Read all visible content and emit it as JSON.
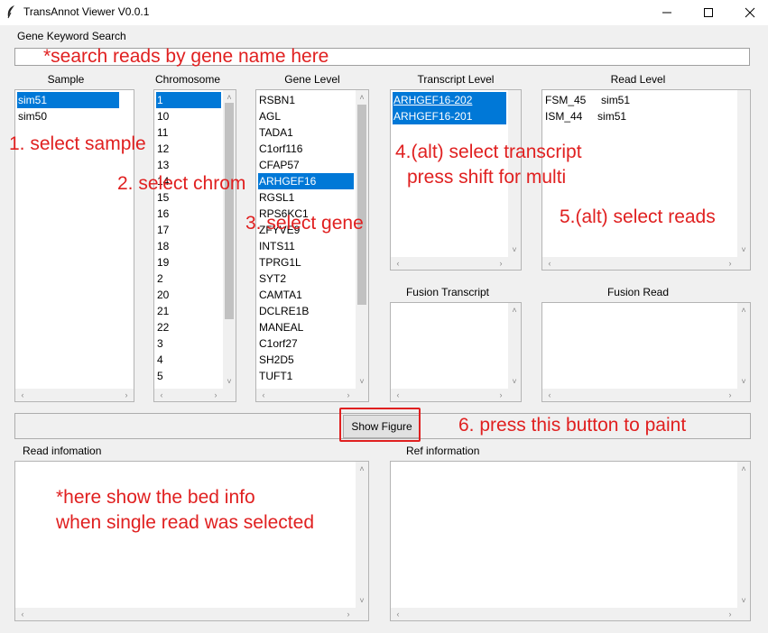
{
  "window": {
    "title": "TransAnnot Viewer V0.0.1",
    "minimize": "—",
    "maximize": "☐",
    "close": "✕"
  },
  "search": {
    "label": "Gene Keyword Search",
    "value": ""
  },
  "sample": {
    "label": "Sample",
    "items": [
      "sim51",
      "sim50"
    ],
    "selected": 0
  },
  "chromosome": {
    "label": "Chromosome",
    "items": [
      "1",
      "10",
      "11",
      "12",
      "13",
      "14",
      "15",
      "16",
      "17",
      "18",
      "19",
      "2",
      "20",
      "21",
      "22",
      "3",
      "4",
      "5"
    ],
    "selected": 0
  },
  "gene": {
    "label": "Gene Level",
    "items": [
      "RSBN1",
      "AGL",
      "TADA1",
      "C1orf116",
      "CFAP57",
      "ARHGEF16",
      "RGSL1",
      "RPS6KC1",
      "ZFYVE9",
      "INTS11",
      "TPRG1L",
      "SYT2",
      "CAMTA1",
      "DCLRE1B",
      "MANEAL",
      "C1orf27",
      "SH2D5",
      "TUFT1"
    ],
    "selected": 5
  },
  "transcript": {
    "label": "Transcript Level",
    "items": [
      "ARHGEF16-202",
      "ARHGEF16-201"
    ],
    "selected": [
      0,
      1
    ]
  },
  "read": {
    "label": "Read Level",
    "items": [
      "FSM_45     sim51",
      "ISM_44     sim51"
    ]
  },
  "fusion_transcript": {
    "label": "Fusion Transcript",
    "items": []
  },
  "fusion_read": {
    "label": "Fusion Read",
    "items": []
  },
  "show_button": {
    "label": "Show Figure"
  },
  "read_info": {
    "label": "Read infomation",
    "text": ""
  },
  "ref_info": {
    "label": "Ref information",
    "text": ""
  },
  "annotations": {
    "search_hint": "*search reads by gene name here",
    "step1": "1. select sample",
    "step2": "2. select chrom",
    "step3": "3. select gene",
    "step4_line1": "4.(alt) select transcript",
    "step4_line2": "press shift for multi",
    "step5": "5.(alt) select reads",
    "step6": "6. press this button to paint",
    "bed_line1": "*here show the bed info",
    "bed_line2": "when single read was selected"
  },
  "colors": {
    "selection": "#0078d7",
    "annotation": "#e02020",
    "background": "#f0f0f0"
  }
}
